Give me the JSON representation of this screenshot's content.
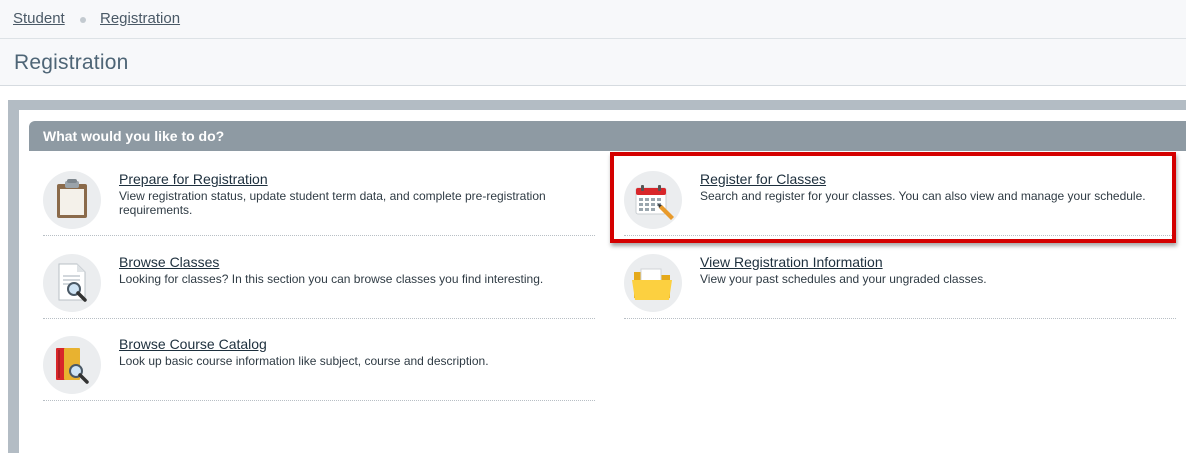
{
  "breadcrumb": {
    "items": [
      "Student",
      "Registration"
    ]
  },
  "page": {
    "title": "Registration"
  },
  "panel": {
    "header": "What would you like to do?",
    "options": [
      {
        "title": "Prepare for Registration",
        "description": "View registration status, update student term data, and complete pre-registration requirements.",
        "icon": "clipboard-icon"
      },
      {
        "title": "Register for Classes",
        "description": "Search and register for your classes. You can also view and manage your schedule.",
        "icon": "calendar-pencil-icon"
      },
      {
        "title": "Browse Classes",
        "description": "Looking for classes? In this section you can browse classes you find interesting.",
        "icon": "document-magnifier-icon"
      },
      {
        "title": "View Registration Information",
        "description": "View your past schedules and your ungraded classes.",
        "icon": "folder-icon"
      },
      {
        "title": "Browse Course Catalog",
        "description": "Look up basic course information like subject, course and description.",
        "icon": "book-magnifier-icon"
      }
    ]
  },
  "colors": {
    "highlight": "#d40000",
    "panel_header": "#8e9aa3",
    "frame": "#b3bcc4"
  }
}
